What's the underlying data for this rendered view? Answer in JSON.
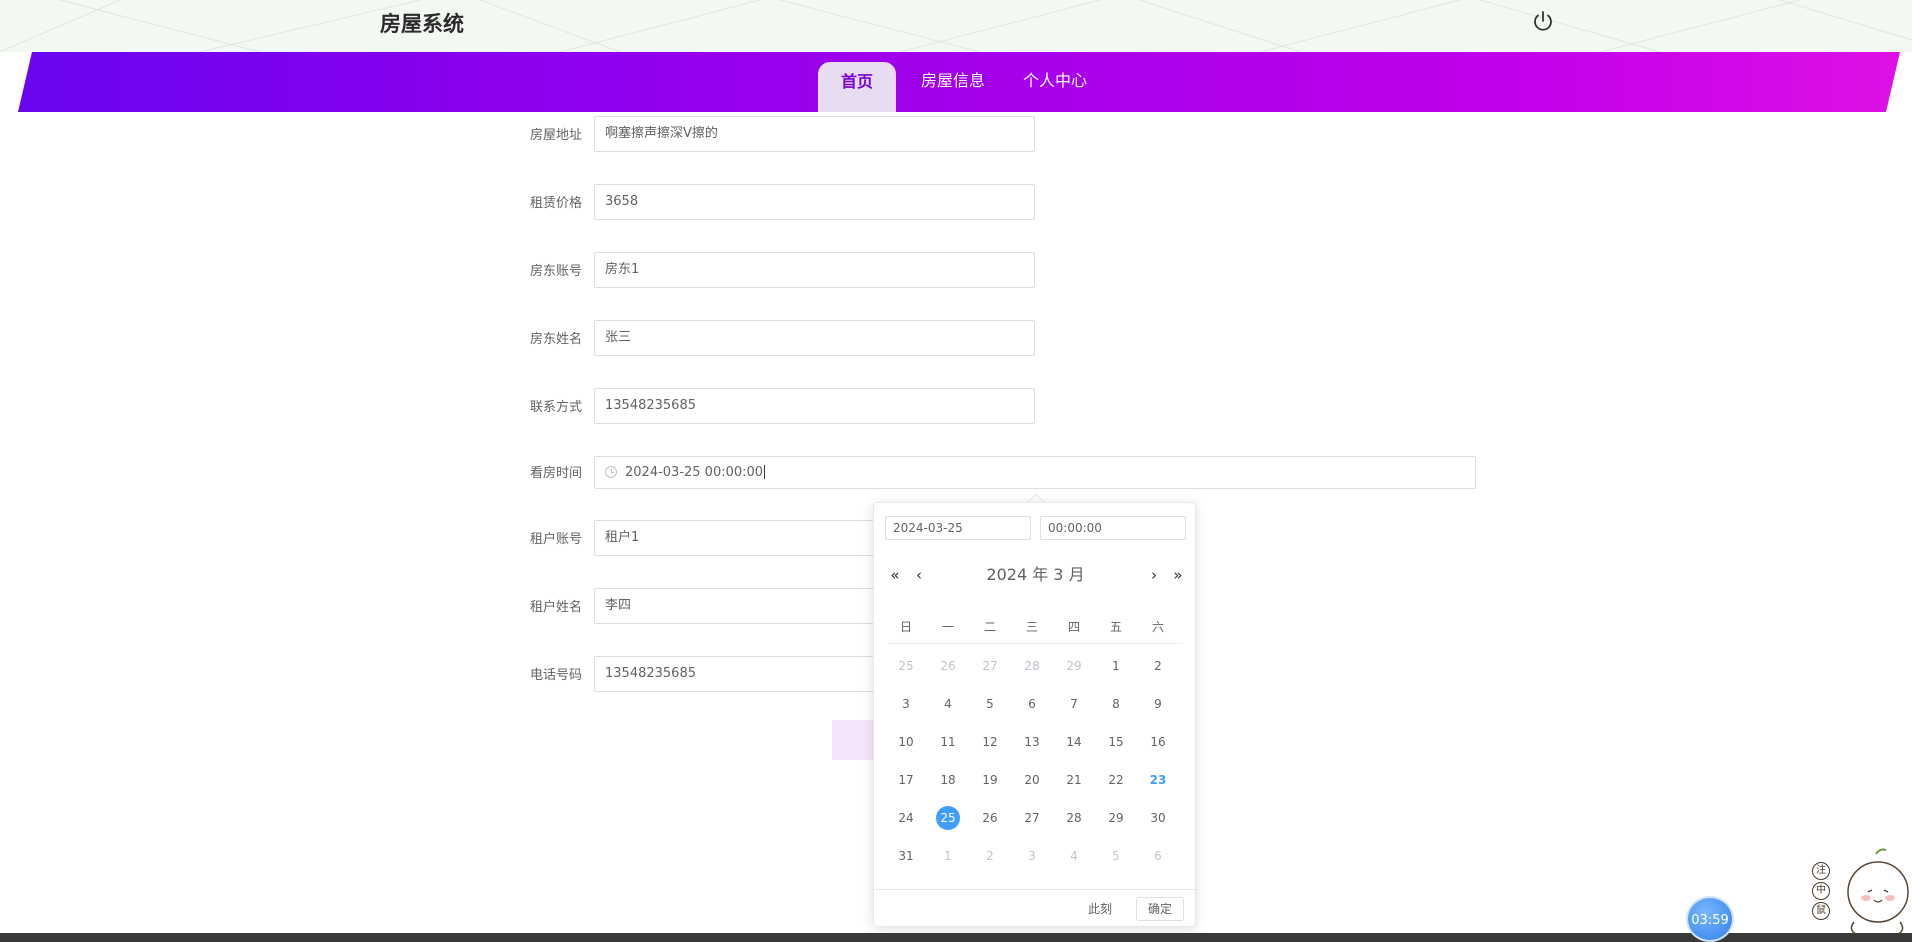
{
  "header": {
    "site_title": "房屋系统"
  },
  "nav": {
    "items": [
      {
        "label": "首页",
        "active": true
      },
      {
        "label": "房屋信息",
        "active": false
      },
      {
        "label": "个人中心",
        "active": false
      }
    ]
  },
  "form": {
    "fields": [
      {
        "label": "房屋地址",
        "value": "啊塞擦声擦深V擦的"
      },
      {
        "label": "租赁价格",
        "value": "3658"
      },
      {
        "label": "房东账号",
        "value": "房东1"
      },
      {
        "label": "房东姓名",
        "value": "张三"
      },
      {
        "label": "联系方式",
        "value": "13548235685"
      },
      {
        "label": "看房时间",
        "value": "2024-03-25 00:00:00"
      },
      {
        "label": "租户账号",
        "value": "租户1"
      },
      {
        "label": "租户姓名",
        "value": "李四"
      },
      {
        "label": "电话号码",
        "value": "13548235685"
      }
    ]
  },
  "datepicker": {
    "date_input": "2024-03-25",
    "time_input": "00:00:00",
    "header": "2024 年  3 月",
    "weekdays": [
      "日",
      "一",
      "二",
      "三",
      "四",
      "五",
      "六"
    ],
    "weeks": [
      [
        "25",
        "26",
        "27",
        "28",
        "29",
        "1",
        "2"
      ],
      [
        "3",
        "4",
        "5",
        "6",
        "7",
        "8",
        "9"
      ],
      [
        "10",
        "11",
        "12",
        "13",
        "14",
        "15",
        "16"
      ],
      [
        "17",
        "18",
        "19",
        "20",
        "21",
        "22",
        "23"
      ],
      [
        "24",
        "25",
        "26",
        "27",
        "28",
        "29",
        "30"
      ],
      [
        "31",
        "1",
        "2",
        "3",
        "4",
        "5",
        "6"
      ]
    ],
    "now_label": "此刻",
    "confirm_label": "确定"
  },
  "timer": {
    "text": "03:59"
  },
  "side_widget": {
    "icons": [
      "注",
      "中",
      "鼠"
    ]
  },
  "colors": {
    "nav_gradient_start": "#6a05f0",
    "nav_gradient_end": "#de10e6",
    "active_tab_text": "#7a00d8",
    "calendar_accent": "#409eff"
  }
}
